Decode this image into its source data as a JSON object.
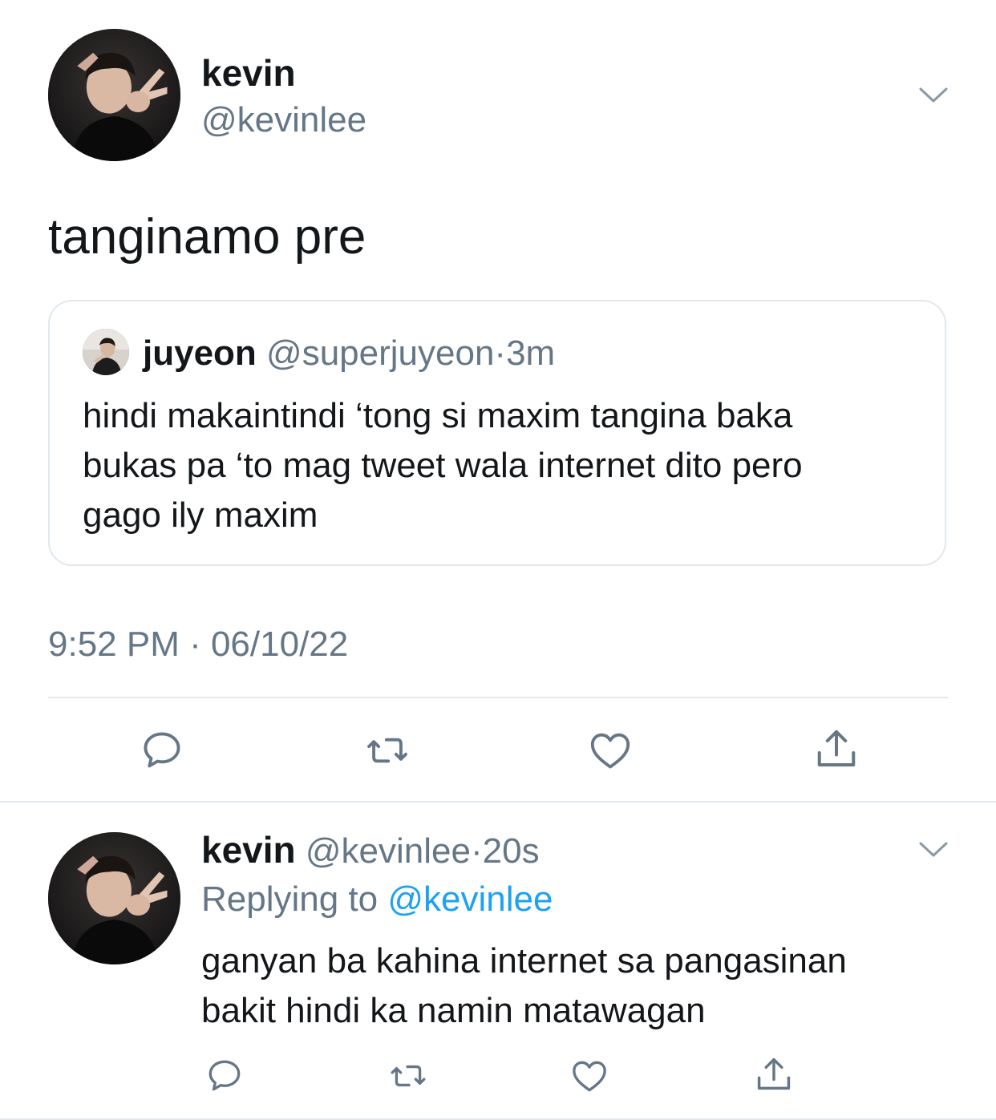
{
  "main_tweet": {
    "author_name": "kevin",
    "author_handle": "@kevinlee",
    "text": "tanginamo pre",
    "timestamp": "9:52 PM · 06/10/22",
    "avatar_icon": "profile-photo",
    "menu_icon": "chevron-down-icon"
  },
  "quoted_tweet": {
    "author_name": "juyeon",
    "author_handle": "@superjuyeon",
    "separator": "·",
    "time_ago": "3m",
    "text_lines": [
      "hindi makaintindi ‘tong si maxim tangina baka",
      "bukas pa ‘to mag tweet wala internet dito pero",
      "gago ily maxim"
    ]
  },
  "reply_tweet": {
    "author_name": "kevin",
    "author_handle": "@kevinlee",
    "separator": "·",
    "time_ago": "20s",
    "replying_prefix": "Replying to",
    "replying_mention": "@kevinlee",
    "text_lines": [
      "ganyan ba kahina internet sa pangasinan",
      "bakit hindi ka namin matawagan"
    ]
  },
  "actions": [
    "reply-icon",
    "retweet-icon",
    "like-icon",
    "share-icon"
  ],
  "colors": {
    "text_primary": "#14171a",
    "text_secondary": "#657786",
    "link": "#1da1f2",
    "border": "#e1e8ed",
    "background": "#ffffff"
  }
}
